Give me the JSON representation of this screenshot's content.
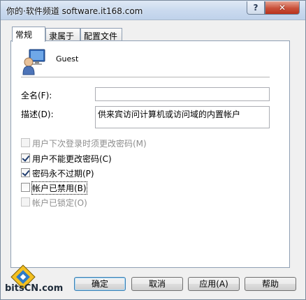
{
  "window": {
    "title": "你的·软件频道 software.it168.com",
    "help_label": "?",
    "close_label": "✕"
  },
  "tabs": [
    {
      "label": "常规",
      "active": true
    },
    {
      "label": "隶属于",
      "active": false
    },
    {
      "label": "配置文件",
      "active": false
    }
  ],
  "user": {
    "name": "Guest",
    "icon": "user-monitor-icon"
  },
  "fields": {
    "fullname_label": "全名(F):",
    "fullname_value": "",
    "description_label": "描述(D):",
    "description_value": "供来宾访问计算机或访问域的内置帐户"
  },
  "checkboxes": [
    {
      "label": "用户下次登录时须更改密码(M)",
      "checked": false,
      "disabled": true
    },
    {
      "label": "用户不能更改密码(C)",
      "checked": true,
      "disabled": false
    },
    {
      "label": "密码永不过期(P)",
      "checked": true,
      "disabled": false
    },
    {
      "label": "帐户已禁用(B)",
      "checked": false,
      "disabled": false
    },
    {
      "label": "帐户已锁定(O)",
      "checked": false,
      "disabled": true
    }
  ],
  "buttons": {
    "ok": "确定",
    "cancel": "取消",
    "apply": "应用(A)",
    "help": "帮助"
  },
  "watermark": {
    "text": "bitsCN.com"
  },
  "colors": {
    "close_red": "#c8503a",
    "title_blue": "#c9d9ee",
    "check_mark": "#1f3c6e"
  }
}
